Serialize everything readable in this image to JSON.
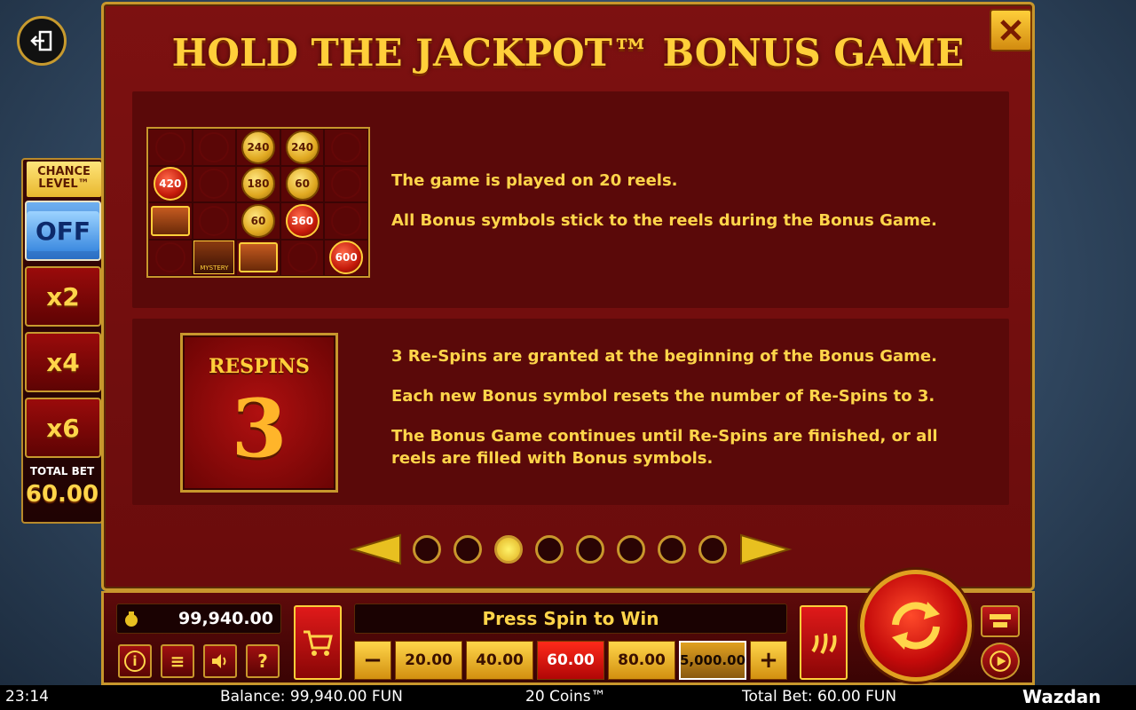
{
  "panel": {
    "title": "HOLD THE JACKPOT™ BONUS GAME",
    "section1": {
      "lines": [
        "The game is played on 20 reels.",
        "All Bonus symbols stick to the reels during the Bonus Game."
      ],
      "grid_values": [
        "240",
        "240",
        "420",
        "180",
        "60",
        "60",
        "360",
        "600"
      ],
      "mystery_label": "MYSTERY"
    },
    "section2": {
      "respins_label": "RESPINS",
      "respins_count": "3",
      "lines": [
        "3 Re-Spins are granted at the beginning of the Bonus Game.",
        "Each new Bonus symbol resets the number of Re-Spins to 3.",
        "The Bonus Game continues until Re-Spins are finished, or all reels are filled with Bonus symbols."
      ]
    },
    "pager": {
      "total": 8,
      "active_index": 2
    }
  },
  "chance": {
    "title_line1": "CHANCE",
    "title_line2": "LEVEL™",
    "off": "OFF",
    "x2": "x2",
    "x4": "x4",
    "x6": "x6",
    "total_bet_label": "TOTAL BET",
    "total_bet_value": "60.00"
  },
  "controls": {
    "balance": "99,940.00",
    "message": "Press Spin to Win",
    "minus": "−",
    "plus": "+",
    "bets": [
      "20.00",
      "40.00",
      "60.00",
      "80.00",
      "5,000.00"
    ],
    "selected_bet": "60.00",
    "info": "i",
    "menu": "≡",
    "help": "?"
  },
  "status": {
    "time": "23:14",
    "balance": "Balance: 99,940.00 FUN",
    "game": "20 Coins™",
    "total_bet": "Total Bet: 60.00 FUN",
    "logo": "Wazdan"
  },
  "colors": {
    "gold": "#ffd54a",
    "panel_red": "#7d1111",
    "section_red": "#5a0909",
    "border_gold": "#c8972c"
  }
}
